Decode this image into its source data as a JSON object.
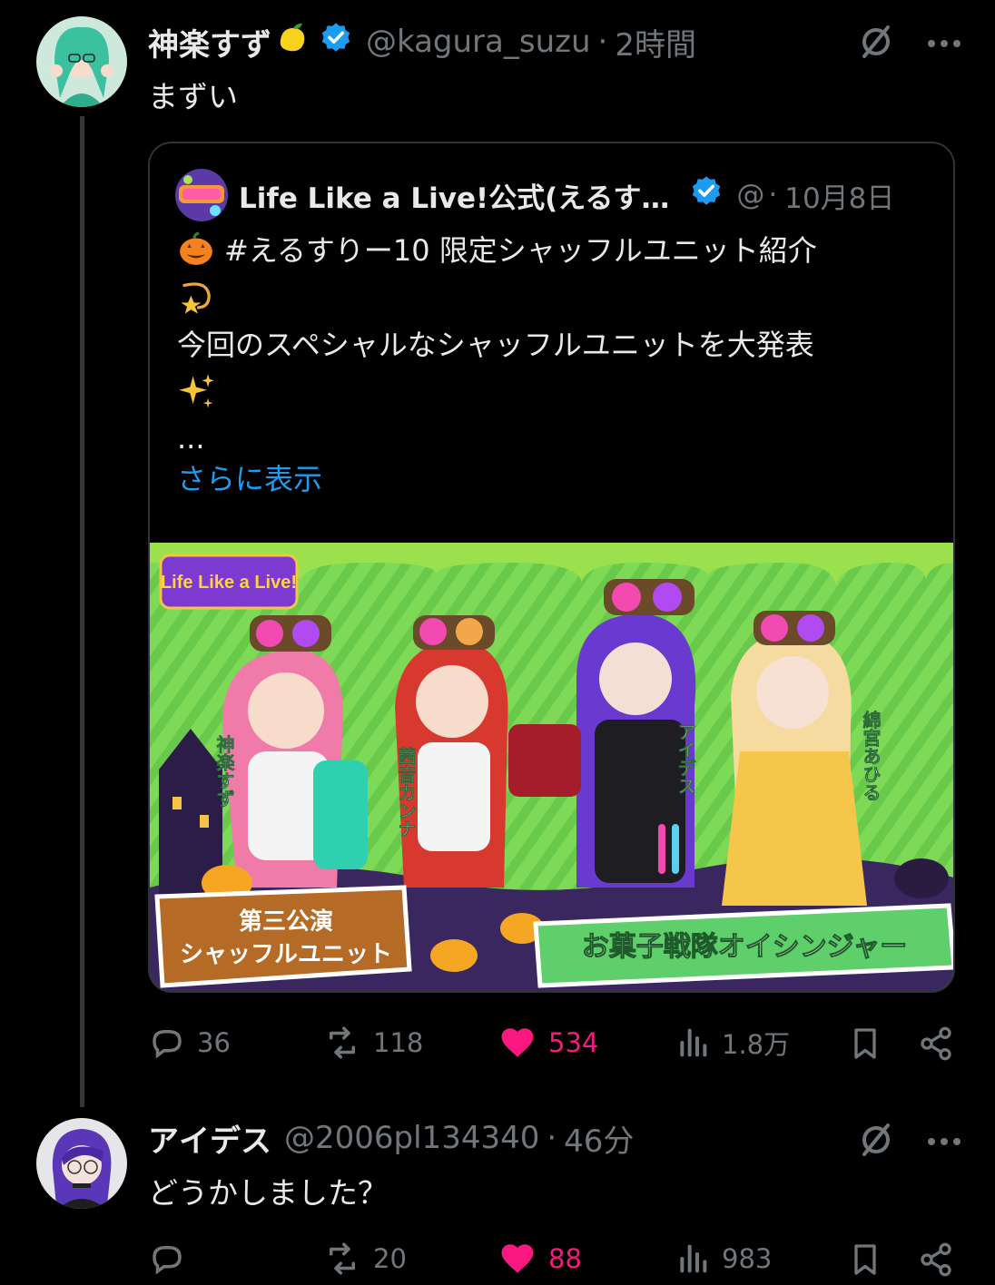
{
  "tweets": [
    {
      "display_name": "神楽すず",
      "badge_emoji": "🍋",
      "verified": true,
      "handle": "@kagura_suzu",
      "separator": "·",
      "time": "2時間",
      "text": "まずい",
      "quote": {
        "display_name": "Life Like a Live!公式(えるす…",
        "handle": "@",
        "separator": "·",
        "time": "10月8日",
        "lines": [
          "#えるすりー10 限定シャッフルユニット紹介",
          "今回のスペシャルなシャッフルユニットを大発表",
          "..."
        ],
        "show_more": "さらに表示",
        "image": {
          "logo_text": "Life Like a Live!",
          "badge_text": "第三公演\nシャッフルユニット",
          "badge_line1": "第三公演",
          "badge_line2": "シャッフルユニット",
          "banner_text": "お菓子戦隊オイシンジャー",
          "characters": [
            "神楽すず",
            "茜音カンナ",
            "アイデス",
            "綿宮あひる"
          ]
        }
      },
      "actions": {
        "replies": "36",
        "retweets": "118",
        "likes": "534",
        "views": "1.8万"
      }
    },
    {
      "display_name": "アイデス",
      "handle": "@2006pl134340",
      "separator": "·",
      "time": "46分",
      "text": "どうかしました？",
      "actions": {
        "replies": "",
        "retweets": "20",
        "likes": "88",
        "views": "983"
      }
    }
  ],
  "colors": {
    "background": "#000000",
    "text": "#e7e9ea",
    "muted": "#71767b",
    "accent": "#1d9bf0",
    "like": "#f91880"
  }
}
